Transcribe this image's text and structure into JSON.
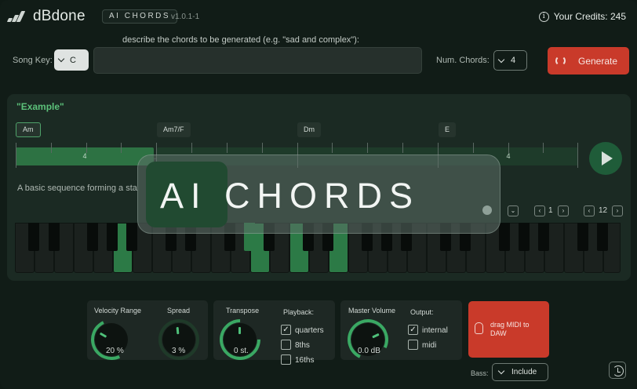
{
  "header": {
    "logo_text": "dBdone",
    "badge": "AI CHORDS",
    "version": "v1.0.1-1",
    "credits": "Your Credits: 245",
    "info_icon": "i"
  },
  "controls": {
    "description_label": "describe the chords to be generated (e.g. \"sad and complex\"):",
    "description_value": "",
    "song_key_label": "Song Key:",
    "song_key_value": "C",
    "num_chords_label": "Num. Chords:",
    "num_chords_value": "4",
    "generate_label": "Generate"
  },
  "example": {
    "title": "\"Example\"",
    "chords": [
      "Am",
      "Am7/F",
      "Dm",
      "E"
    ],
    "bar_left_value": "4",
    "bar_right_value": "4",
    "description": "A basic sequence forming a sta",
    "octave_value": "1",
    "transpose_value": "12"
  },
  "banner": {
    "text": "AI CHORDS"
  },
  "velocity": {
    "label": "Velocity Range",
    "value": "20 %"
  },
  "spread": {
    "label": "Spread",
    "value": "3 %"
  },
  "transpose": {
    "label": "Transpose",
    "value": "0 st."
  },
  "playback": {
    "label": "Playback:",
    "options": [
      {
        "label": "quarters",
        "checked": true
      },
      {
        "label": "8ths",
        "checked": false
      },
      {
        "label": "16ths",
        "checked": false
      }
    ]
  },
  "master_volume": {
    "label": "Master Volume",
    "value": "0.0 dB"
  },
  "output": {
    "label": "Output:",
    "options": [
      {
        "label": "internal",
        "checked": true
      },
      {
        "label": "midi",
        "checked": false
      }
    ]
  },
  "drag": {
    "label": "drag MIDI to DAW"
  },
  "bass": {
    "label": "Bass:",
    "value": "Include"
  },
  "colors": {
    "accent_green": "#2c7a46",
    "title_green": "#5cc17a",
    "action_red": "#c93a2a",
    "background": "#111c17"
  }
}
